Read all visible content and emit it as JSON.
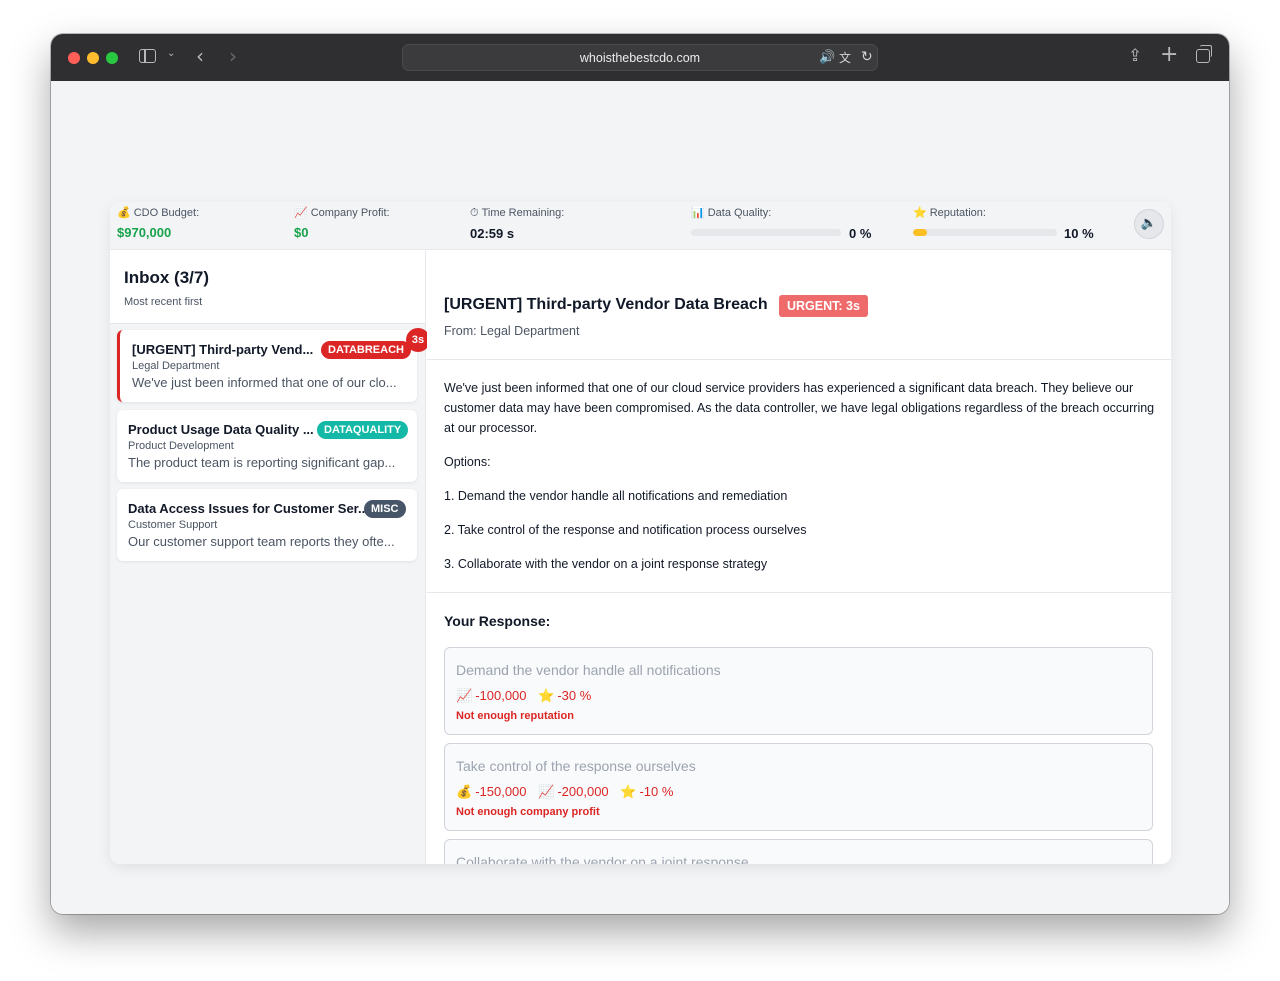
{
  "browser": {
    "url": "whoisthebestcdo.com"
  },
  "stats": {
    "budget": {
      "label": "CDO Budget:",
      "icon": "money-bag-icon",
      "value": "$970,000"
    },
    "profit": {
      "label": "Company Profit:",
      "icon": "chart-increasing-icon",
      "value": "$0"
    },
    "time": {
      "label": "Time Remaining:",
      "icon": "stopwatch-icon",
      "value": "02:59 s"
    },
    "quality": {
      "label": "Data Quality:",
      "icon": "bar-chart-icon",
      "value_text": "0 %",
      "level": 0
    },
    "reputation": {
      "label": "Reputation:",
      "icon": "star-icon",
      "value_text": "10 %",
      "level": 0.1
    },
    "colors": {
      "positive": "#16a34a",
      "meter": "#fbbf24"
    }
  },
  "inbox": {
    "title": "Inbox (3/7)",
    "subtitle": "Most recent first",
    "items": [
      {
        "title": "[URGENT] Third-party Vend...",
        "tag": "DATABREACH",
        "timer": "3s",
        "from": "Legal Department",
        "preview": "We've just been informed that one of our clo..."
      },
      {
        "title": "Product Usage Data Quality ...",
        "tag": "DATAQUALITY",
        "from": "Product Development",
        "preview": "The product team is reporting significant gap..."
      },
      {
        "title": "Data Access Issues for Customer Ser...",
        "tag": "MISC",
        "from": "Customer Support",
        "preview": "Our customer support team reports they ofte..."
      }
    ]
  },
  "detail": {
    "title": "[URGENT] Third-party Vendor Data Breach",
    "badge": "URGENT: 3s",
    "from": "From: Legal Department",
    "body": "We've just been informed that one of our cloud service providers has experienced a significant data breach. They believe our customer data may have been compromised. As the data controller, we have legal obligations regardless of the breach occurring at our processor.",
    "options_heading": "Options:",
    "options": [
      "1. Demand the vendor handle all notifications and remediation",
      "2. Take control of the response and notification process ourselves",
      "3. Collaborate with the vendor on a joint response strategy"
    ]
  },
  "response": {
    "heading": "Your Response:",
    "choices": [
      {
        "label": "Demand the vendor handle all notifications",
        "effects": [
          {
            "icon": "chart-increasing-icon",
            "text": "-100,000"
          },
          {
            "icon": "star-icon",
            "text": "-30 %"
          }
        ],
        "warning": "Not enough reputation"
      },
      {
        "label": "Take control of the response ourselves",
        "effects": [
          {
            "icon": "money-bag-icon",
            "text": "-150,000"
          },
          {
            "icon": "chart-increasing-icon",
            "text": "-200,000"
          },
          {
            "icon": "star-icon",
            "text": "-10 %"
          }
        ],
        "warning": "Not enough company profit"
      },
      {
        "label": "Collaborate with the vendor on a joint response"
      }
    ]
  }
}
